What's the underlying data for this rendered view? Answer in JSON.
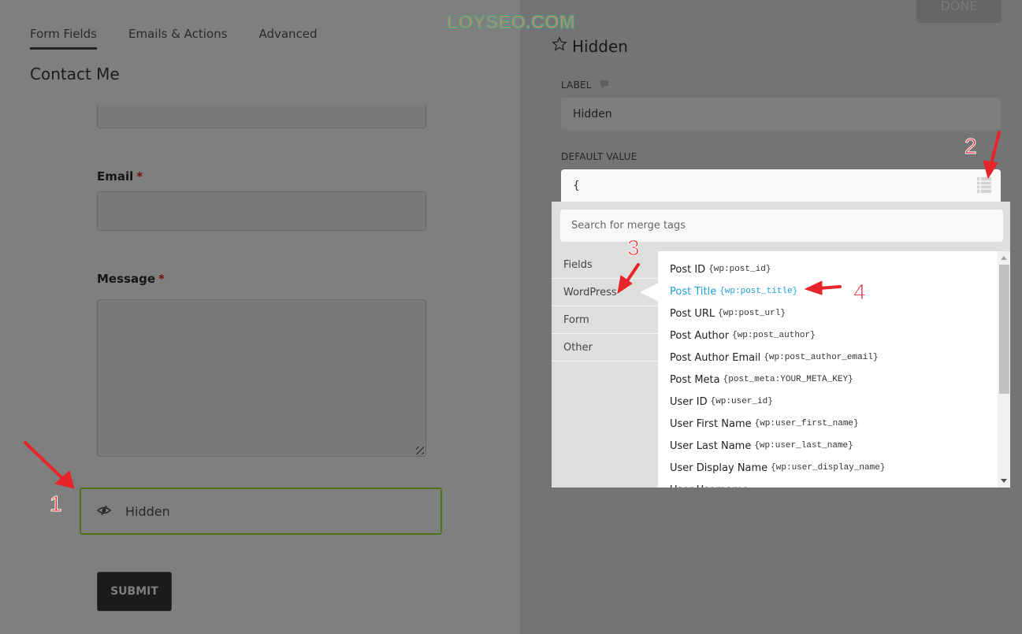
{
  "tabs": [
    {
      "label": "Form Fields",
      "active": true
    },
    {
      "label": "Emails & Actions",
      "active": false
    },
    {
      "label": "Advanced",
      "active": false
    }
  ],
  "form": {
    "title": "Contact Me",
    "fields": [
      {
        "label": "Email",
        "required_mark": "*",
        "value": ""
      },
      {
        "label": "Message",
        "required_mark": "*",
        "value": ""
      }
    ],
    "hidden_field": {
      "label": "Hidden",
      "icon": "eye-slash-icon"
    },
    "submit_label": "SUBMIT"
  },
  "panel": {
    "done_label": "DONE",
    "title": "Hidden",
    "title_icon": "star-icon",
    "label_heading": "LABEL",
    "label_value": "Hidden",
    "default_heading": "DEFAULT VALUE",
    "default_value": "{",
    "merge_tags": {
      "search_placeholder": "Search for merge tags",
      "categories": [
        {
          "label": "Fields",
          "active": false
        },
        {
          "label": "WordPress",
          "active": true
        },
        {
          "label": "Form",
          "active": false
        },
        {
          "label": "Other",
          "active": false
        }
      ],
      "items": [
        {
          "label": "Post ID",
          "tag": "{wp:post_id}"
        },
        {
          "label": "Post Title",
          "tag": "{wp:post_title}",
          "active": true
        },
        {
          "label": "Post URL",
          "tag": "{wp:post_url}"
        },
        {
          "label": "Post Author",
          "tag": "{wp:post_author}"
        },
        {
          "label": "Post Author Email",
          "tag": "{wp:post_author_email}"
        },
        {
          "label": "Post Meta",
          "tag": "{post_meta:YOUR_META_KEY}"
        },
        {
          "label": "User ID",
          "tag": "{wp:user_id}"
        },
        {
          "label": "User First Name",
          "tag": "{wp:user_first_name}"
        },
        {
          "label": "User Last Name",
          "tag": "{wp:user_last_name}"
        },
        {
          "label": "User Display Name",
          "tag": "{wp:user_display_name}"
        },
        {
          "label": "User Username",
          "tag": ""
        }
      ]
    }
  },
  "annotations": {
    "watermark": "LOYSEO.COM",
    "steps": [
      "1",
      "2",
      "3",
      "4"
    ],
    "color": "#e8242b"
  },
  "colors": {
    "accent_green": "#4e7419",
    "active_tag": "#1ea0d5",
    "required": "#7a0d0d"
  }
}
